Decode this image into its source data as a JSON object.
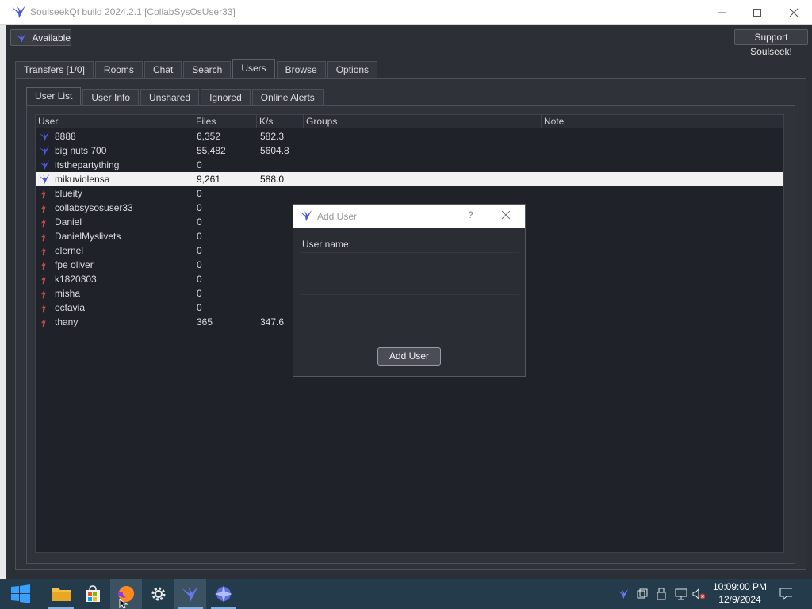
{
  "window": {
    "title": "SoulseekQt build 2024.2.1 [CollabSysOsUser33]"
  },
  "toolbar": {
    "status_label": "Available",
    "support_label": "Support Soulseek!"
  },
  "main_tabs": [
    {
      "label": "Transfers [1/0]",
      "active": false
    },
    {
      "label": "Rooms",
      "active": false
    },
    {
      "label": "Chat",
      "active": false
    },
    {
      "label": "Search",
      "active": false
    },
    {
      "label": "Users",
      "active": true
    },
    {
      "label": "Browse",
      "active": false
    },
    {
      "label": "Options",
      "active": false
    }
  ],
  "sub_tabs": [
    {
      "label": "User List",
      "active": true
    },
    {
      "label": "User Info",
      "active": false
    },
    {
      "label": "Unshared",
      "active": false
    },
    {
      "label": "Ignored",
      "active": false
    },
    {
      "label": "Online Alerts",
      "active": false
    }
  ],
  "user_table": {
    "columns": [
      "User",
      "Files",
      "K/s",
      "Groups",
      "Note"
    ],
    "rows": [
      {
        "user": "8888",
        "files": "6,352",
        "speed": "582.3",
        "groups": "",
        "note": "",
        "status": "online",
        "selected": false
      },
      {
        "user": "big nuts 700",
        "files": "55,482",
        "speed": "5604.8",
        "groups": "",
        "note": "",
        "status": "online",
        "selected": false
      },
      {
        "user": "itsthepartything",
        "files": "0",
        "speed": "",
        "groups": "",
        "note": "",
        "status": "online",
        "selected": false
      },
      {
        "user": "mikuviolensa",
        "files": "9,261",
        "speed": "588.0",
        "groups": "",
        "note": "",
        "status": "online",
        "selected": true
      },
      {
        "user": "blueity",
        "files": "0",
        "speed": "",
        "groups": "",
        "note": "",
        "status": "offline",
        "selected": false
      },
      {
        "user": "collabsysosuser33",
        "files": "0",
        "speed": "",
        "groups": "",
        "note": "",
        "status": "offline",
        "selected": false
      },
      {
        "user": "Daniel",
        "files": "0",
        "speed": "",
        "groups": "",
        "note": "",
        "status": "offline",
        "selected": false
      },
      {
        "user": "DanielMyslivets",
        "files": "0",
        "speed": "",
        "groups": "",
        "note": "",
        "status": "offline",
        "selected": false
      },
      {
        "user": "elernel",
        "files": "0",
        "speed": "",
        "groups": "",
        "note": "",
        "status": "offline",
        "selected": false
      },
      {
        "user": "fpe oliver",
        "files": "0",
        "speed": "",
        "groups": "",
        "note": "",
        "status": "offline",
        "selected": false
      },
      {
        "user": "k1820303",
        "files": "0",
        "speed": "",
        "groups": "",
        "note": "",
        "status": "offline",
        "selected": false
      },
      {
        "user": "misha",
        "files": "0",
        "speed": "",
        "groups": "",
        "note": "",
        "status": "offline",
        "selected": false
      },
      {
        "user": "octavia",
        "files": "0",
        "speed": "",
        "groups": "",
        "note": "",
        "status": "offline",
        "selected": false
      },
      {
        "user": "thany",
        "files": "365",
        "speed": "347.6",
        "groups": "",
        "note": "",
        "status": "offline",
        "selected": false
      }
    ]
  },
  "dialog": {
    "title": "Add User",
    "help_label": "?",
    "field_label": "User name:",
    "field_value": "",
    "button_label": "Add User"
  },
  "taskbar": {
    "time": "10:09:00 PM",
    "date": "12/9/2024",
    "icons": [
      "windows-start-icon",
      "file-explorer-icon",
      "store-icon",
      "firefox-icon",
      "settings-icon",
      "soulseek-icon",
      "globe-app-icon"
    ]
  },
  "colors": {
    "online_icon": "#4a55d8",
    "offline_icon": "#c0504a",
    "selection": "#f2f2f2",
    "background": "#2c2f35"
  }
}
